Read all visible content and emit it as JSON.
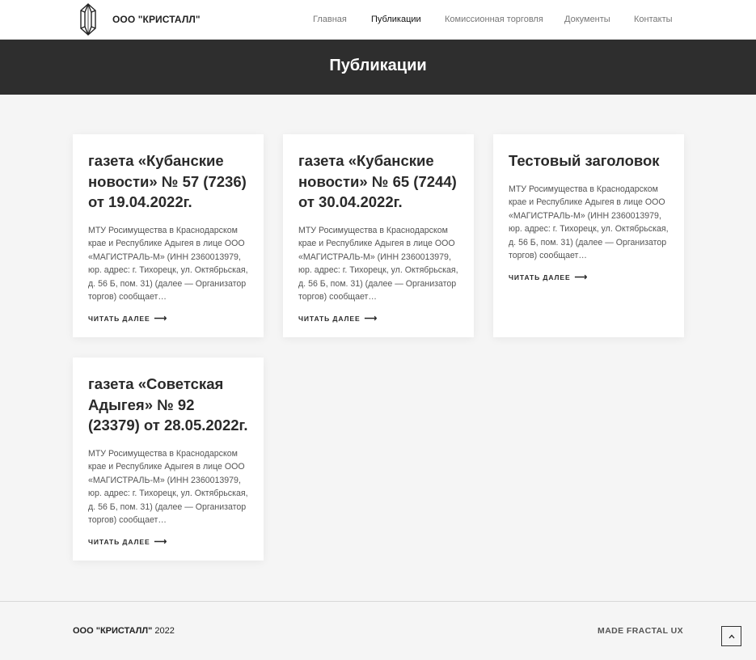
{
  "header": {
    "site_name": "ООО \"КРИСТАЛЛ\"",
    "logo_icon": "crystal-logo-icon",
    "nav": [
      {
        "label": "Главная",
        "active": false
      },
      {
        "label": "Публикации",
        "active": true
      },
      {
        "label": "Комиссионная торговля",
        "active": false
      },
      {
        "label": "Документы",
        "active": false
      },
      {
        "label": "Контакты",
        "active": false
      }
    ]
  },
  "banner": {
    "title": "Публикации"
  },
  "posts": [
    {
      "title": "газета «Кубанские новости» № 57 (7236) от 19.04.2022г.",
      "excerpt": "МТУ Росимущества в Краснодарском крае и Республике Адыгея в лице ООО «МАГИСТРАЛЬ-М» (ИНН 2360013979, юр. адрес: г. Тихорецк, ул. Октябрьская, д. 56 Б, пом. 31) (далее — Организатор торгов) сообщает…",
      "more": "ЧИТАТЬ ДАЛЕЕ"
    },
    {
      "title": "газета «Кубанские новости» № 65 (7244) от 30.04.2022г.",
      "excerpt": "МТУ Росимущества в Краснодарском крае и Республике Адыгея в лице ООО «МАГИСТРАЛЬ-М» (ИНН 2360013979, юр. адрес: г. Тихорецк, ул. Октябрьская, д. 56 Б, пом. 31) (далее — Организатор торгов) сообщает…",
      "more": "ЧИТАТЬ ДАЛЕЕ"
    },
    {
      "title": "Тестовый заголовок",
      "excerpt": "МТУ Росимущества в Краснодарском крае и Республике Адыгея в лице ООО «МАГИСТРАЛЬ-М» (ИНН 2360013979, юр. адрес: г. Тихорецк, ул. Октябрьская, д. 56 Б, пом. 31) (далее — Организатор торгов) сообщает…",
      "more": "ЧИТАТЬ ДАЛЕЕ"
    },
    {
      "title": "газета «Советская Адыгея» № 92 (23379) от 28.05.2022г.",
      "excerpt": "МТУ Росимущества в Краснодарском крае и Республике Адыгея в лице ООО «МАГИСТРАЛЬ-М» (ИНН 2360013979, юр. адрес: г. Тихорецк, ул. Октябрьская, д. 56 Б, пом. 31) (далее — Организатор торгов) сообщает…",
      "more": "ЧИТАТЬ ДАЛЕЕ"
    }
  ],
  "footer": {
    "company": "ООО \"КРИСТАЛЛ\"",
    "year": "2022",
    "credit": "MADE FRACTAL UX",
    "to_top_icon": "chevron-up-icon"
  },
  "colors": {
    "banner_bg": "#2e2e2e",
    "page_bg": "#f5f5f5",
    "card_bg": "#ffffff"
  }
}
